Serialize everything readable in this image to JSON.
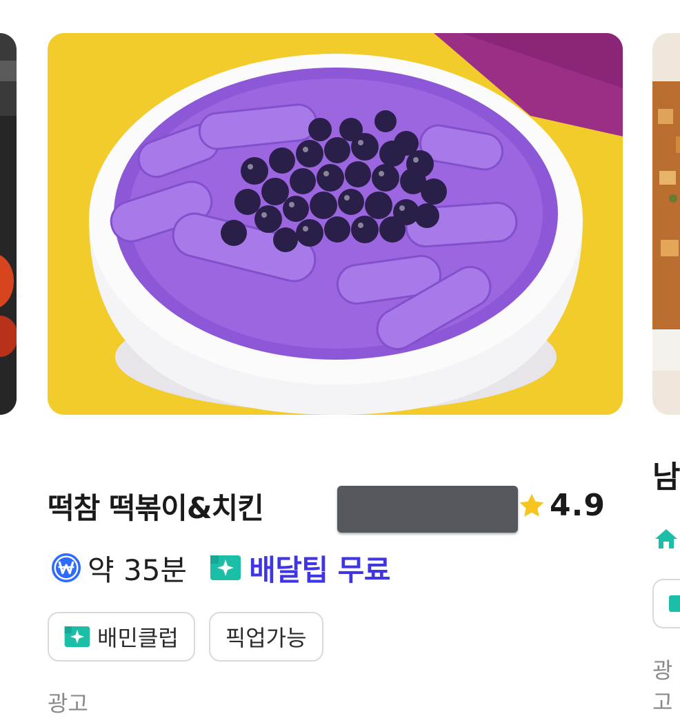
{
  "store": {
    "name": "떡참 떡볶이&치킨",
    "rating": "4.9",
    "delivery_time": "약 35분",
    "delivery_tip": "배달팁 무료",
    "chips": [
      "배민클럽",
      "픽업가능"
    ],
    "ad_label": "광고"
  },
  "next_store": {
    "name_fragment": "남",
    "ad_fragment": "광고"
  },
  "colors": {
    "accent_purple": "#3f35e5",
    "club_teal": "#1bbfa8",
    "star_yellow": "#f7c520",
    "won_blue": "#2f6bff"
  },
  "icons": [
    "won-coupon-icon",
    "baemin-club-icon",
    "star-icon",
    "home-icon"
  ]
}
